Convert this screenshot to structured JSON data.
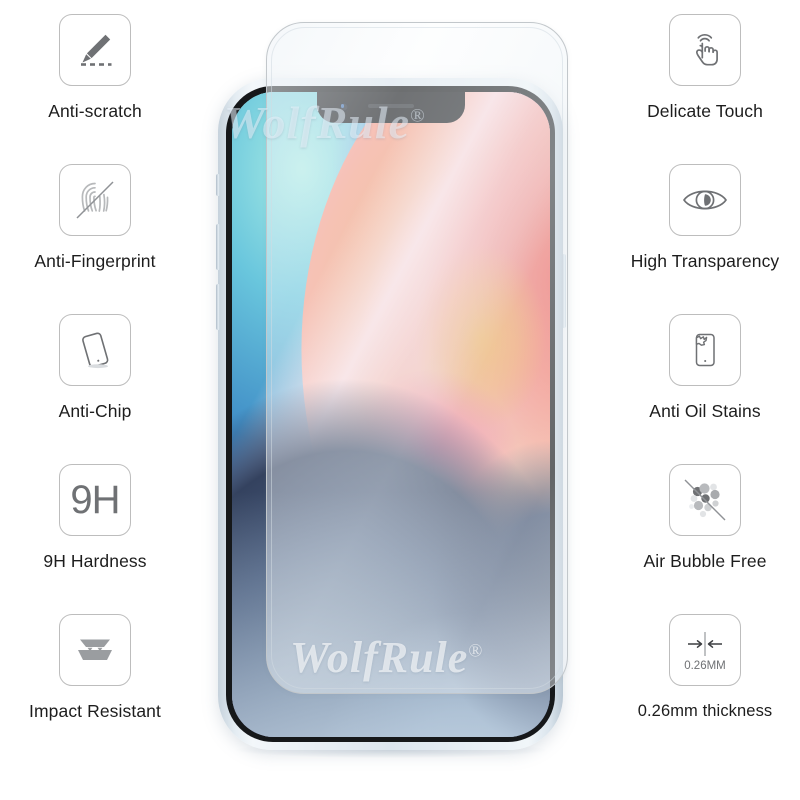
{
  "product": {
    "brand_watermark": "WolfRule",
    "brand_mark_symbol": "®"
  },
  "left_features": [
    {
      "icon": "pen-scratch-icon",
      "label": "Anti-scratch"
    },
    {
      "icon": "fingerprint-slash-icon",
      "label": "Anti-Fingerprint"
    },
    {
      "icon": "phone-tilted-icon",
      "label": "Anti-Chip"
    },
    {
      "icon": "9h-hardness-icon",
      "label": "9H Hardness",
      "icon_text": "9H"
    },
    {
      "icon": "impact-layers-icon",
      "label": "Impact Resistant"
    }
  ],
  "right_features": [
    {
      "icon": "touch-hand-icon",
      "label": "Delicate Touch"
    },
    {
      "icon": "eye-icon",
      "label": "High Transparency"
    },
    {
      "icon": "oil-drop-phone-icon",
      "label": "Anti Oil Stains"
    },
    {
      "icon": "bubbles-slash-icon",
      "label": "Air Bubble Free"
    },
    {
      "icon": "thickness-arrows-icon",
      "label": "0.26mm thickness",
      "icon_text": "0.26MM"
    }
  ],
  "colors": {
    "label_text": "#1d1d1d",
    "icon_stroke": "#6f7174",
    "icon_box_border": "#bdbdbd",
    "background": "#ffffff"
  }
}
